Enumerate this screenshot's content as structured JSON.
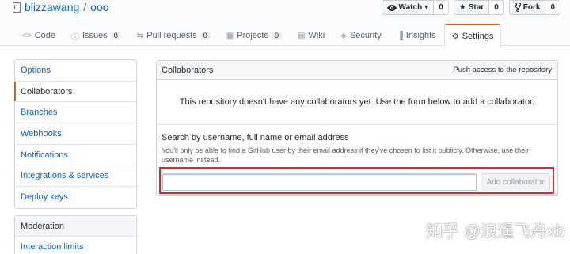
{
  "repo": {
    "owner": "blizzawang",
    "separator": "/",
    "name": "ooo"
  },
  "actions": [
    {
      "label": "Watch",
      "icon": "eye-icon",
      "caret": "▾",
      "count": "0"
    },
    {
      "label": "Star",
      "icon": "star-icon",
      "count": "0"
    },
    {
      "label": "Fork",
      "icon": "fork-icon",
      "count": "0"
    }
  ],
  "tabs": [
    {
      "label": "Code",
      "icon": "code-icon",
      "glyph": "<>"
    },
    {
      "label": "Issues",
      "icon": "issue-icon",
      "glyph": "ⓘ",
      "count": "0"
    },
    {
      "label": "Pull requests",
      "icon": "pull-request-icon",
      "glyph": "⇆",
      "count": "0"
    },
    {
      "label": "Projects",
      "icon": "project-icon",
      "glyph": "▦",
      "count": "0"
    },
    {
      "label": "Wiki",
      "icon": "book-icon",
      "glyph": "▤"
    },
    {
      "label": "Security",
      "icon": "shield-icon",
      "glyph": "◈"
    },
    {
      "label": "Insights",
      "icon": "graph-icon",
      "glyph": "▐"
    },
    {
      "label": "Settings",
      "icon": "gear-icon",
      "glyph": "⚙",
      "selected": true
    }
  ],
  "sidebar": {
    "items": [
      "Options",
      "Collaborators",
      "Branches",
      "Webhooks",
      "Notifications",
      "Integrations & services",
      "Deploy keys"
    ],
    "selected": "Collaborators",
    "moderation": {
      "heading": "Moderation",
      "items": [
        "Interaction limits"
      ]
    }
  },
  "collaborators": {
    "title": "Collaborators",
    "meta": "Push access to the repository",
    "empty_message": "This repository doesn't have any collaborators yet. Use the form below to add a collaborator.",
    "search_label": "Search by username, full name or email address",
    "note": "You'll only be able to find a GitHub user by their email address if they've chosen to list it publicly. Otherwise, use their username instead.",
    "input_value": "",
    "add_button": "Add collaborator"
  },
  "watermark": {
    "text": "知乎 @浪遥飞舟xb"
  },
  "colors": {
    "link": "#0366d6",
    "selected_accent": "#e36209",
    "highlight_box": "#e0262b"
  }
}
